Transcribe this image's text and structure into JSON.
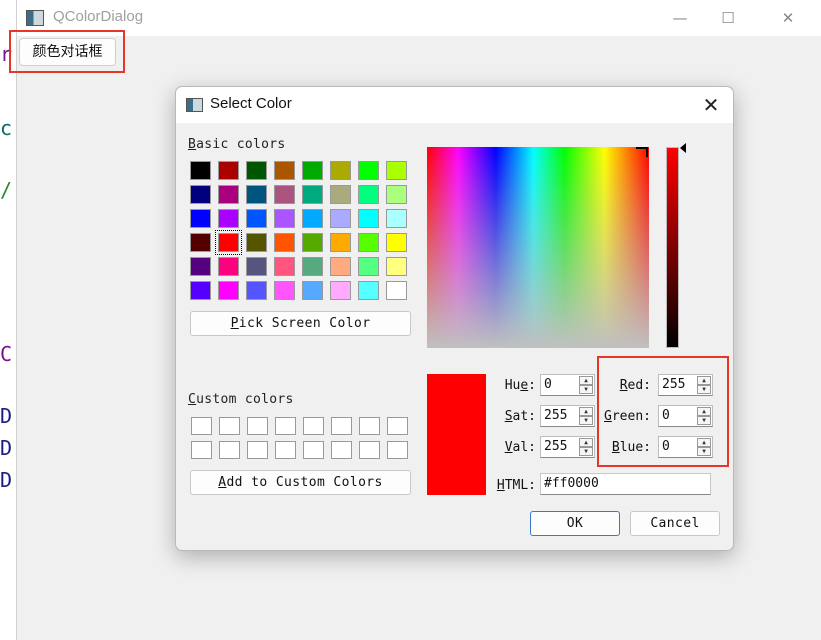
{
  "background": {
    "fragments": [
      {
        "text": "r",
        "color": "#7a0f8f"
      },
      {
        "text": "c",
        "color": "#0a6a6a"
      },
      {
        "text": "/",
        "color": "#2a8a2a"
      },
      {
        "text": "C",
        "color": "#7a0f8f"
      },
      {
        "text": "D",
        "color": "#1a1a8a"
      },
      {
        "text": "D",
        "color": "#1a1a8a"
      },
      {
        "text": "D",
        "color": "#1a1a8a"
      }
    ]
  },
  "main_window": {
    "title": "QColorDialog",
    "open_button_label": "颜色对话框",
    "controls": {
      "minimize": "—",
      "maximize": "☐",
      "close": "✕"
    }
  },
  "dialog": {
    "title": "Select Color",
    "close_glyph": "✕",
    "basic_colors_label": {
      "u": "B",
      "rest": "asic colors"
    },
    "basic_colors": [
      [
        "#000000",
        "#aa0000",
        "#005500",
        "#aa5500",
        "#00aa00",
        "#aaaa00",
        "#00ff00",
        "#aaff00"
      ],
      [
        "#00007f",
        "#aa007f",
        "#00557f",
        "#aa557f",
        "#00aa7f",
        "#aaaa7f",
        "#00ff7f",
        "#aaff7f"
      ],
      [
        "#0000ff",
        "#aa00ff",
        "#0055ff",
        "#aa55ff",
        "#00aaff",
        "#aaaaff",
        "#00ffff",
        "#aaffff"
      ],
      [
        "#550000",
        "#ff0000",
        "#555500",
        "#ff5500",
        "#55aa00",
        "#ffaa00",
        "#55ff00",
        "#ffff00"
      ],
      [
        "#55007f",
        "#ff007f",
        "#55557f",
        "#ff557f",
        "#55aa7f",
        "#ffaa7f",
        "#55ff7f",
        "#ffff7f"
      ],
      [
        "#5500ff",
        "#ff00ff",
        "#5555ff",
        "#ff55ff",
        "#55aaff",
        "#ffaaff",
        "#55ffff",
        "#ffffff"
      ]
    ],
    "selected_swatch": {
      "row": 3,
      "col": 1
    },
    "pick_screen_label": {
      "u": "P",
      "rest": "ick Screen Color"
    },
    "custom_colors_label": {
      "u": "C",
      "rest": "ustom colors"
    },
    "custom_rows": 2,
    "custom_cols": 8,
    "add_custom_label": {
      "u": "A",
      "rest": "dd to Custom Colors"
    },
    "current_color": "#ff0000",
    "hue": {
      "label_pre": "Hu",
      "label_u": "e",
      "label_post": ":",
      "value": "0"
    },
    "sat": {
      "label_pre": "",
      "label_u": "S",
      "label_post": "at:",
      "value": "255"
    },
    "val": {
      "label_pre": "",
      "label_u": "V",
      "label_post": "al:",
      "value": "255"
    },
    "red": {
      "label_pre": "",
      "label_u": "R",
      "label_post": "ed:",
      "value": "255"
    },
    "green": {
      "label_pre": "",
      "label_u": "G",
      "label_post": "reen:",
      "value": "0"
    },
    "blue": {
      "label_pre": "",
      "label_u": "B",
      "label_post": "lue:",
      "value": "0"
    },
    "html": {
      "label_u": "H",
      "label_post": "TML:",
      "value": "#ff0000"
    },
    "ok_label": "OK",
    "cancel_label": "Cancel"
  },
  "highlight_color": "#e8352a"
}
